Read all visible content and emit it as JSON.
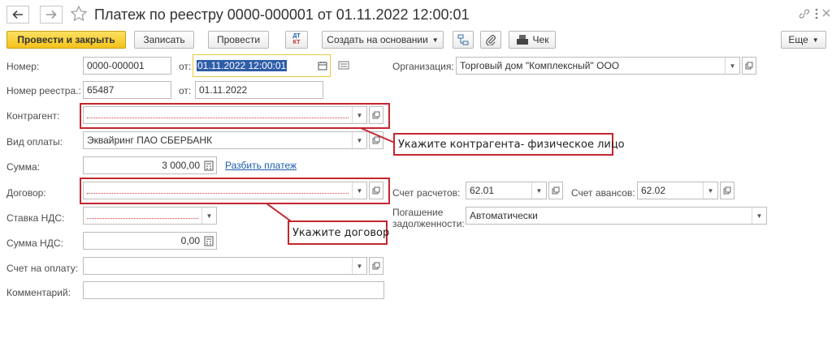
{
  "header": {
    "title": "Платеж по реестру 0000-000001 от 01.11.2022 12:00:01",
    "more_icon": "more-vertical-icon",
    "link_icon": "link-icon",
    "close_icon": "close-icon"
  },
  "toolbar": {
    "post_close": "Провести и закрыть",
    "save": "Записать",
    "post": "Провести",
    "dtkt_top": "ДТ",
    "dtkt_bottom": "КТ",
    "create_basis": "Создать на основании",
    "receipt": "Чек",
    "more": "Еще"
  },
  "form": {
    "number_label": "Номер:",
    "number_value": "0000-000001",
    "from_label": "от:",
    "date_value": "01.11.2022 12:00:01",
    "org_label": "Организация:",
    "org_value": "Торговый дом \"Комплексный\" ООО",
    "registry_label": "Номер реестра.:",
    "registry_value": "65487",
    "registry_from_label": "от:",
    "registry_date": "01.11.2022",
    "counterparty_label": "Контрагент:",
    "counterparty_value": "",
    "payment_type_label": "Вид оплаты:",
    "payment_type_value": "Эквайринг ПАО СБЕРБАНК",
    "amount_label": "Сумма:",
    "amount_value": "3 000,00",
    "split_link": "Разбить платеж",
    "contract_label": "Договор:",
    "contract_value": "",
    "settlement_account_label": "Счет расчетов:",
    "settlement_account_value": "62.01",
    "advance_account_label": "Счет авансов:",
    "advance_account_value": "62.02",
    "vat_rate_label": "Ставка НДС:",
    "vat_rate_value": "",
    "debt_repayment_label_1": "Погашение",
    "debt_repayment_label_2": "задолженности:",
    "debt_repayment_value": "Автоматически",
    "vat_amount_label": "Сумма НДС:",
    "vat_amount_value": "0,00",
    "invoice_label": "Счет на оплату:",
    "invoice_value": "",
    "comment_label": "Комментарий:",
    "comment_value": ""
  },
  "annotations": {
    "counterparty_hint": "Укажите контрагента- физическое лицо",
    "contract_hint": "Укажите договор",
    "accent_color": "#c4262e"
  }
}
